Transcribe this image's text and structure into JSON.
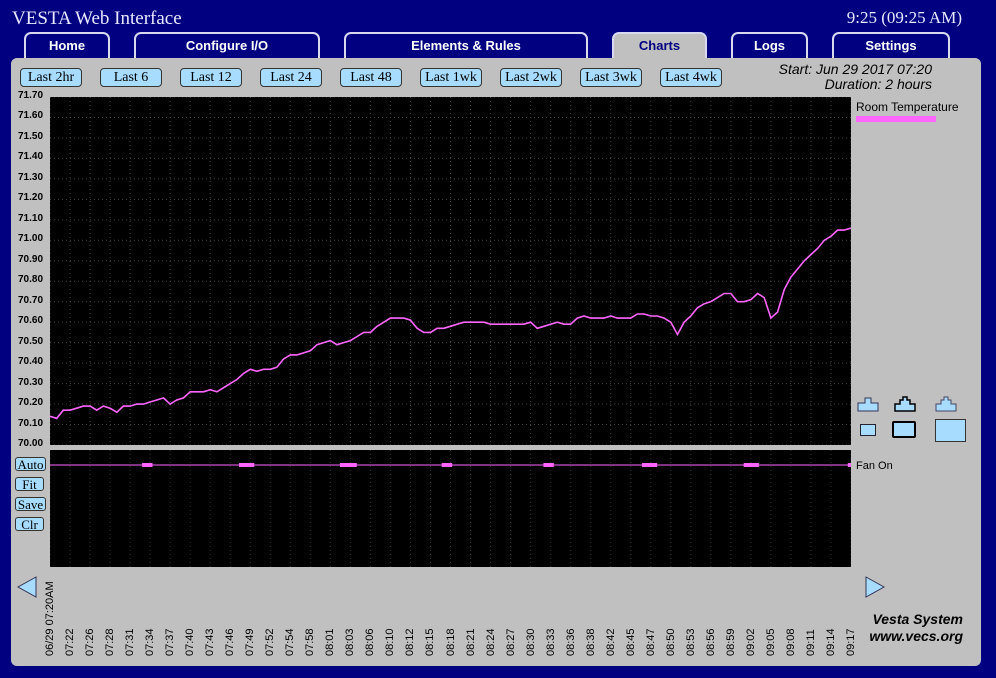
{
  "app": {
    "title": "VESTA Web Interface",
    "clock": "9:25 (09:25 AM)"
  },
  "tabs": [
    {
      "label": "Home"
    },
    {
      "label": "Configure I/O"
    },
    {
      "label": "Elements & Rules"
    },
    {
      "label": "Charts",
      "active": true
    },
    {
      "label": "Logs"
    },
    {
      "label": "Settings"
    }
  ],
  "ranges": [
    "Last 2hr",
    "Last 6",
    "Last 12",
    "Last 24",
    "Last 48",
    "Last 1wk",
    "Last 2wk",
    "Last 3wk",
    "Last 4wk"
  ],
  "info": {
    "start": "Start: Jun 29 2017 07:20",
    "duration": "Duration: 2 hours"
  },
  "side_buttons": [
    "Auto",
    "Fit",
    "Save",
    "Clr"
  ],
  "footer": {
    "line1": "Vesta System",
    "line2": "www.vecs.org"
  },
  "colors": {
    "series": "#ff66ff",
    "plot_bg": "#000000",
    "panel": "#c0c0c0",
    "page_bg": "#000080",
    "button": "#a7dcff"
  },
  "chart_data": [
    {
      "type": "line",
      "title": "",
      "xlabel": "",
      "ylabel": "",
      "ylim": [
        70.0,
        71.7
      ],
      "y_ticks": [
        "71.70",
        "71.60",
        "71.50",
        "71.40",
        "71.30",
        "71.20",
        "71.10",
        "71.00",
        "70.90",
        "70.80",
        "70.70",
        "70.60",
        "70.50",
        "70.40",
        "70.30",
        "70.20",
        "70.10",
        "70.00"
      ],
      "x_ticks": [
        "06/29 07:20AM",
        "07:22",
        "07:26",
        "07:28",
        "07:31",
        "07:34",
        "07:37",
        "07:40",
        "07:43",
        "07:46",
        "07:49",
        "07:52",
        "07:54",
        "07:58",
        "08:01",
        "08:03",
        "08:06",
        "08:10",
        "08:12",
        "08:15",
        "08:18",
        "08:21",
        "08:24",
        "08:27",
        "08:30",
        "08:33",
        "08:36",
        "08:38",
        "08:42",
        "08:45",
        "08:47",
        "08:50",
        "08:53",
        "08:56",
        "08:59",
        "09:02",
        "09:05",
        "09:08",
        "09:11",
        "09:14",
        "09:17"
      ],
      "grid": true,
      "legend": "right",
      "series": [
        {
          "name": "Room Temperature",
          "color": "#ff66ff",
          "x": [
            0,
            1,
            2,
            3,
            4,
            5,
            6,
            7,
            8,
            9,
            10,
            11,
            12,
            13,
            14,
            15,
            16,
            17,
            18,
            19,
            20,
            21,
            22,
            23,
            24,
            25,
            26,
            27,
            28,
            29,
            30,
            31,
            32,
            33,
            34,
            35,
            36,
            37,
            38,
            39,
            40,
            41,
            42,
            43,
            44,
            45,
            46,
            47,
            48,
            49,
            50,
            51,
            52,
            53,
            54,
            55,
            56,
            57,
            58,
            59,
            60,
            61,
            62,
            63,
            64,
            65,
            66,
            67,
            68,
            69,
            70,
            71,
            72,
            73,
            74,
            75,
            76,
            77,
            78,
            79,
            80,
            81,
            82,
            83,
            84,
            85,
            86,
            87,
            88,
            89,
            90,
            91,
            92,
            93,
            94,
            95,
            96,
            97,
            98,
            99,
            100,
            101,
            102,
            103,
            104,
            105,
            106,
            107,
            108,
            109,
            110,
            111,
            112,
            113,
            114,
            115,
            116,
            117,
            118,
            119,
            120
          ],
          "values": [
            70.14,
            70.13,
            70.17,
            70.17,
            70.18,
            70.19,
            70.19,
            70.17,
            70.19,
            70.18,
            70.16,
            70.19,
            70.19,
            70.2,
            70.2,
            70.21,
            70.22,
            70.23,
            70.2,
            70.22,
            70.23,
            70.26,
            70.26,
            70.26,
            70.27,
            70.26,
            70.28,
            70.3,
            70.32,
            70.35,
            70.37,
            70.36,
            70.37,
            70.37,
            70.38,
            70.42,
            70.44,
            70.44,
            70.45,
            70.46,
            70.49,
            70.5,
            70.51,
            70.49,
            70.5,
            70.51,
            70.53,
            70.55,
            70.55,
            70.58,
            70.6,
            70.62,
            70.62,
            70.62,
            70.61,
            70.57,
            70.55,
            70.55,
            70.57,
            70.57,
            70.58,
            70.59,
            70.6,
            70.6,
            70.6,
            70.6,
            70.59,
            70.59,
            70.59,
            70.59,
            70.59,
            70.59,
            70.6,
            70.57,
            70.58,
            70.59,
            70.6,
            70.59,
            70.59,
            70.62,
            70.63,
            70.62,
            70.62,
            70.62,
            70.63,
            70.62,
            70.62,
            70.62,
            70.64,
            70.64,
            70.63,
            70.63,
            70.62,
            70.6,
            70.54,
            70.6,
            70.63,
            70.67,
            70.69,
            70.7,
            70.72,
            70.74,
            70.74,
            70.7,
            70.7,
            70.71,
            70.74,
            70.72,
            70.62,
            70.65,
            70.76,
            70.82,
            70.86,
            70.9,
            70.93,
            70.96,
            71.0,
            71.02,
            71.05,
            71.05,
            71.06
          ]
        }
      ]
    },
    {
      "type": "line",
      "title": "",
      "series": [
        {
          "name": "Fan On",
          "color": "#ff66ff",
          "on_intervals_fraction": [
            [
              0.115,
              0.128
            ],
            [
              0.236,
              0.255
            ],
            [
              0.362,
              0.383
            ],
            [
              0.489,
              0.502
            ],
            [
              0.616,
              0.629
            ],
            [
              0.739,
              0.758
            ],
            [
              0.866,
              0.885
            ],
            [
              0.996,
              1.0
            ]
          ]
        }
      ]
    }
  ]
}
